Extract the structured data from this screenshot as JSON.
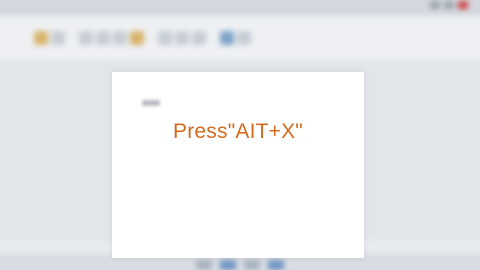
{
  "instruction_overlay": {
    "text": "Press\"AIT+X\""
  },
  "colors": {
    "instruction_text": "#d46a1e",
    "page": "#ffffff",
    "background": "#dfe3e8"
  }
}
